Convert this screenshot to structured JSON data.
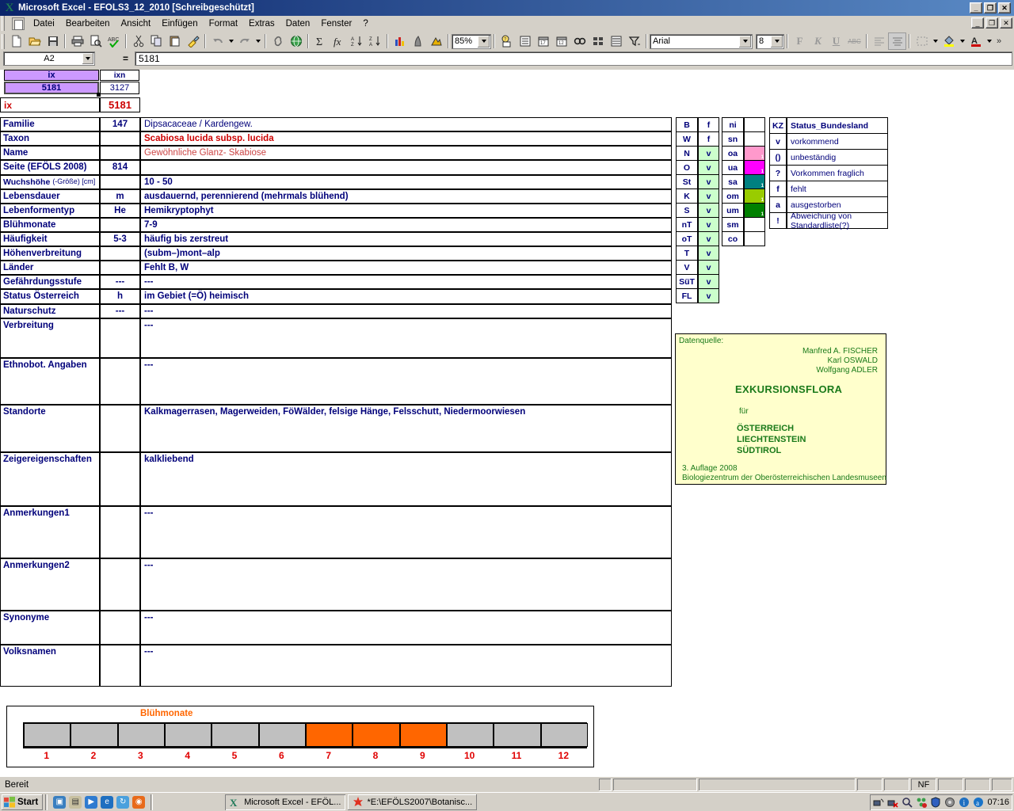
{
  "window": {
    "title": "Microsoft Excel - EFÖLS3_12_2010  [Schreibgeschützt]",
    "app_icon": "excel-x-icon",
    "minimize": "_",
    "maximize": "❐",
    "close": "✕"
  },
  "menubar": {
    "items": [
      "Datei",
      "Bearbeiten",
      "Ansicht",
      "Einfügen",
      "Format",
      "Extras",
      "Daten",
      "Fenster",
      "?"
    ]
  },
  "toolbar": {
    "zoom": "85%",
    "font_name": "Arial",
    "font_size": "8",
    "bold_label": "F",
    "italic_label": "K",
    "underline_label": "U",
    "strike_label": "ABC"
  },
  "formula_bar": {
    "name_box": "A2",
    "equals": "=",
    "formula": "5181"
  },
  "header_cells": {
    "col_a_header": "ix",
    "col_b_header": "ixn",
    "col_a_value": "5181",
    "col_b_value": "3127",
    "ix_label": "ix",
    "ix_value": "5181"
  },
  "rows": [
    {
      "label": "Familie",
      "code": "147",
      "value": "Dipsacaceae  /  Kardengew.",
      "style": "plain"
    },
    {
      "label": "Taxon",
      "code": "",
      "value": "Scabiosa lucida subsp. lucida",
      "style": "taxon"
    },
    {
      "label": "Name",
      "code": "",
      "value": "Gewöhnliche Glanz- Skabiose",
      "style": "nameval"
    },
    {
      "label": "Seite (EFÖLS 2008)",
      "code": "814",
      "value": "",
      "style": "normal"
    },
    {
      "label": "Wuchshöhe (-Größe) [cm]",
      "code": "",
      "value": "10 - 50",
      "style": "normal"
    },
    {
      "label": "Lebensdauer",
      "code": "m",
      "value": "ausdauernd, perennierend (mehrmals blühend)",
      "style": "normal"
    },
    {
      "label": "Lebenformentyp",
      "code": "He",
      "value": "Hemikryptophyt",
      "style": "normal"
    },
    {
      "label": "Blühmonate",
      "code": "",
      "value": "7-9",
      "style": "normal"
    },
    {
      "label": "Häufigkeit",
      "code": "5-3",
      "value": "häufig bis zerstreut",
      "style": "normal"
    },
    {
      "label": "Höhenverbreitung",
      "code": "",
      "value": "(subm–)mont–alp",
      "style": "normal"
    },
    {
      "label": "Länder",
      "code": "",
      "value": "Fehlt B, W",
      "style": "normal"
    },
    {
      "label": "Gefährdungsstufe",
      "code": "---",
      "value": "---",
      "style": "normal"
    },
    {
      "label": "Status Österreich",
      "code": "h",
      "value": "im Gebiet (=Ö) heimisch",
      "style": "normal"
    },
    {
      "label": "Naturschutz",
      "code": "---",
      "value": "---",
      "style": "normal"
    },
    {
      "label": "Verbreitung",
      "code": "",
      "value": "---",
      "style": "normal"
    },
    {
      "label": "Ethnobot. Angaben",
      "code": "",
      "value": "---",
      "style": "normal"
    },
    {
      "label": "Standorte",
      "code": "",
      "value": "Kalkmagerrasen, Magerweiden, FöWälder, felsige Hänge, Felsschutt, Niedermoorwiesen",
      "style": "normal"
    },
    {
      "label": "Zeigereigenschaften",
      "code": "",
      "value": "kalkliebend",
      "style": "normal"
    },
    {
      "label": "Anmerkungen1",
      "code": "",
      "value": "---",
      "style": "normal"
    },
    {
      "label": "Anmerkungen2",
      "code": "",
      "value": "---",
      "style": "normal"
    },
    {
      "label": "Synonyme",
      "code": "",
      "value": "---",
      "style": "normal"
    },
    {
      "label": "Volksnamen",
      "code": "",
      "value": "---",
      "style": "normal"
    }
  ],
  "province_grid": {
    "col1": [
      {
        "code": "B",
        "status": "f",
        "green": false
      },
      {
        "code": "W",
        "status": "f",
        "green": false
      },
      {
        "code": "N",
        "status": "v",
        "green": true
      },
      {
        "code": "O",
        "status": "v",
        "green": true
      },
      {
        "code": "St",
        "status": "v",
        "green": true
      },
      {
        "code": "K",
        "status": "v",
        "green": true
      },
      {
        "code": "S",
        "status": "v",
        "green": true
      },
      {
        "code": "nT",
        "status": "v",
        "green": true
      },
      {
        "code": "oT",
        "status": "v",
        "green": true
      },
      {
        "code": "T",
        "status": "v",
        "green": true
      },
      {
        "code": "V",
        "status": "v",
        "green": true
      },
      {
        "code": "SüT",
        "status": "v",
        "green": true
      },
      {
        "code": "FL",
        "status": "v",
        "green": true
      }
    ],
    "col2": [
      {
        "code": "ni",
        "status": "",
        "color": ""
      },
      {
        "code": "sn",
        "status": "",
        "color": ""
      },
      {
        "code": "oa",
        "status": "1",
        "color": "#ff99cc"
      },
      {
        "code": "ua",
        "status": "1",
        "color": "#ff00ff"
      },
      {
        "code": "sa",
        "status": "1",
        "color": "#008080"
      },
      {
        "code": "om",
        "status": "1",
        "color": "#99cc00"
      },
      {
        "code": "um",
        "status": "1",
        "color": "#008000"
      },
      {
        "code": "sm",
        "status": "",
        "color": ""
      },
      {
        "code": "co",
        "status": "",
        "color": ""
      }
    ]
  },
  "legend": {
    "header_code": "KZ",
    "header_desc": "Status_Bundesland",
    "entries": [
      {
        "code": "v",
        "desc": "vorkommend"
      },
      {
        "code": "()",
        "desc": "unbeständig"
      },
      {
        "code": "?",
        "desc": "Vorkommen fraglich"
      },
      {
        "code": "f",
        "desc": "fehlt"
      },
      {
        "code": "a",
        "desc": "ausgestorben"
      },
      {
        "code": "!",
        "desc": "Abweichung von Standardliste(?)"
      }
    ]
  },
  "source_box": {
    "caption": "Datenquelle:",
    "authors": [
      "Manfred A. FISCHER",
      "Karl OSWALD",
      "Wolfgang ADLER"
    ],
    "title": "EXKURSIONSFLORA",
    "fuer": "für",
    "regions": [
      "ÖSTERREICH",
      "LIECHTENSTEIN",
      "SÜDTIROL"
    ],
    "edition": "3. Auflage 2008",
    "publisher": "Biologiezentrum der Oberösterreichischen Landesmuseen"
  },
  "chart_data": {
    "type": "bar",
    "title": "Blühmonate",
    "categories": [
      "1",
      "2",
      "3",
      "4",
      "5",
      "6",
      "7",
      "8",
      "9",
      "10",
      "11",
      "12"
    ],
    "values": [
      0,
      0,
      0,
      0,
      0,
      0,
      1,
      1,
      1,
      0,
      0,
      0
    ],
    "active_color": "#ff6600",
    "inactive_color": "#c0c0c0",
    "label_color": "#e00000",
    "xlabel": "",
    "ylabel": "",
    "ylim": [
      0,
      1
    ],
    "grid": false,
    "legend": "none"
  },
  "statusbar": {
    "message": "Bereit",
    "indicator": "NF"
  },
  "taskbar": {
    "start": "Start",
    "quicklaunch": [
      "show-desktop-icon",
      "notes-icon",
      "media-player-icon",
      "internet-explorer-icon",
      "sync-icon",
      "firefox-icon"
    ],
    "tasks": [
      {
        "icon": "excel-x-icon",
        "label": "Microsoft Excel - EFÖL..."
      },
      {
        "icon": "star-red-icon",
        "label": "*E:\\EFÖLS2007\\Botanisc..."
      }
    ],
    "tray_icons": [
      "network-icon",
      "network-disconnected-icon",
      "search-icon",
      "network-error-icon",
      "shield-icon",
      "volume-icon",
      "info-icon",
      "acrobat-icon"
    ],
    "clock": "07:16"
  }
}
